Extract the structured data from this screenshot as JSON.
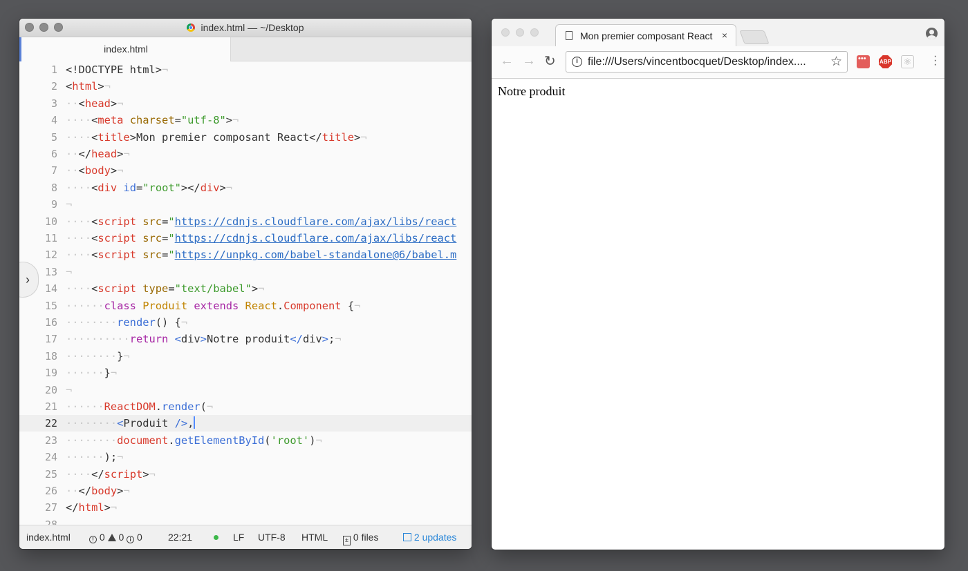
{
  "editor": {
    "window_title": "index.html — ~/Desktop",
    "tab_label": "index.html",
    "lines": [
      {
        "n": "1",
        "tokens": [
          [
            "pl",
            "<!DOCTYPE html>"
          ],
          [
            "eol",
            "¬"
          ]
        ]
      },
      {
        "n": "2",
        "tokens": [
          [
            "pl",
            "<"
          ],
          [
            "tag",
            "html"
          ],
          [
            "pl",
            ">"
          ],
          [
            "eol",
            "¬"
          ]
        ]
      },
      {
        "n": "3",
        "tokens": [
          [
            "ind",
            "··"
          ],
          [
            "pl",
            "<"
          ],
          [
            "tag",
            "head"
          ],
          [
            "pl",
            ">"
          ],
          [
            "eol",
            "¬"
          ]
        ]
      },
      {
        "n": "4",
        "tokens": [
          [
            "ind",
            "····"
          ],
          [
            "pl",
            "<"
          ],
          [
            "tag",
            "meta"
          ],
          [
            "pl",
            " "
          ],
          [
            "attr",
            "charset"
          ],
          [
            "pl",
            "="
          ],
          [
            "str",
            "\"utf-8\""
          ],
          [
            "pl",
            ">"
          ],
          [
            "eol",
            "¬"
          ]
        ]
      },
      {
        "n": "5",
        "tokens": [
          [
            "ind",
            "····"
          ],
          [
            "pl",
            "<"
          ],
          [
            "tag",
            "title"
          ],
          [
            "pl",
            ">Mon premier composant React</"
          ],
          [
            "tag",
            "title"
          ],
          [
            "pl",
            ">"
          ],
          [
            "eol",
            "¬"
          ]
        ]
      },
      {
        "n": "6",
        "tokens": [
          [
            "ind",
            "··"
          ],
          [
            "pl",
            "</"
          ],
          [
            "tag",
            "head"
          ],
          [
            "pl",
            ">"
          ],
          [
            "eol",
            "¬"
          ]
        ]
      },
      {
        "n": "7",
        "tokens": [
          [
            "ind",
            "··"
          ],
          [
            "pl",
            "<"
          ],
          [
            "tag",
            "body"
          ],
          [
            "pl",
            ">"
          ],
          [
            "eol",
            "¬"
          ]
        ]
      },
      {
        "n": "8",
        "tokens": [
          [
            "ind",
            "····"
          ],
          [
            "pl",
            "<"
          ],
          [
            "tag",
            "div"
          ],
          [
            "pl",
            " "
          ],
          [
            "fn",
            "id"
          ],
          [
            "pl",
            "="
          ],
          [
            "str",
            "\"root\""
          ],
          [
            "pl",
            "></"
          ],
          [
            "tag",
            "div"
          ],
          [
            "pl",
            ">"
          ],
          [
            "eol",
            "¬"
          ]
        ]
      },
      {
        "n": "9",
        "tokens": [
          [
            "eol",
            "¬"
          ]
        ]
      },
      {
        "n": "10",
        "tokens": [
          [
            "ind",
            "····"
          ],
          [
            "pl",
            "<"
          ],
          [
            "tag",
            "script"
          ],
          [
            "pl",
            " "
          ],
          [
            "attr",
            "src"
          ],
          [
            "pl",
            "="
          ],
          [
            "str",
            "\""
          ],
          [
            "url",
            "https://cdnjs.cloudflare.com/ajax/libs/react"
          ]
        ]
      },
      {
        "n": "11",
        "tokens": [
          [
            "ind",
            "····"
          ],
          [
            "pl",
            "<"
          ],
          [
            "tag",
            "script"
          ],
          [
            "pl",
            " "
          ],
          [
            "attr",
            "src"
          ],
          [
            "pl",
            "="
          ],
          [
            "str",
            "\""
          ],
          [
            "url",
            "https://cdnjs.cloudflare.com/ajax/libs/react"
          ]
        ]
      },
      {
        "n": "12",
        "tokens": [
          [
            "ind",
            "····"
          ],
          [
            "pl",
            "<"
          ],
          [
            "tag",
            "script"
          ],
          [
            "pl",
            " "
          ],
          [
            "attr",
            "src"
          ],
          [
            "pl",
            "="
          ],
          [
            "str",
            "\""
          ],
          [
            "url",
            "https://unpkg.com/babel-standalone@6/babel.m"
          ]
        ]
      },
      {
        "n": "13",
        "tokens": [
          [
            "eol",
            "¬"
          ]
        ]
      },
      {
        "n": "14",
        "tokens": [
          [
            "ind",
            "····"
          ],
          [
            "pl",
            "<"
          ],
          [
            "tag",
            "script"
          ],
          [
            "pl",
            " "
          ],
          [
            "attr",
            "type"
          ],
          [
            "pl",
            "="
          ],
          [
            "str",
            "\"text/babel\""
          ],
          [
            "pl",
            ">"
          ],
          [
            "eol",
            "¬"
          ]
        ]
      },
      {
        "n": "15",
        "tokens": [
          [
            "ind",
            "······"
          ],
          [
            "kw",
            "class"
          ],
          [
            "pl",
            " "
          ],
          [
            "cls",
            "Produit"
          ],
          [
            "pl",
            " "
          ],
          [
            "kw",
            "extends"
          ],
          [
            "pl",
            " "
          ],
          [
            "cls",
            "React"
          ],
          [
            "pl",
            "."
          ],
          [
            "obj",
            "Component"
          ],
          [
            "pl",
            " {"
          ],
          [
            "eol",
            "¬"
          ]
        ]
      },
      {
        "n": "16",
        "tokens": [
          [
            "ind",
            "········"
          ],
          [
            "fn",
            "render"
          ],
          [
            "pl",
            "() {"
          ],
          [
            "eol",
            "¬"
          ]
        ]
      },
      {
        "n": "17",
        "tokens": [
          [
            "ind",
            "··········"
          ],
          [
            "kw",
            "return"
          ],
          [
            "pl",
            " "
          ],
          [
            "fn",
            "<"
          ],
          [
            "pl",
            "div"
          ],
          [
            "fn",
            ">"
          ],
          [
            "pl",
            "Notre produit"
          ],
          [
            "fn",
            "</"
          ],
          [
            "pl",
            "div"
          ],
          [
            "fn",
            ">"
          ],
          [
            "pl",
            ";"
          ],
          [
            "eol",
            "¬"
          ]
        ]
      },
      {
        "n": "18",
        "tokens": [
          [
            "ind",
            "········"
          ],
          [
            "pl",
            "}"
          ],
          [
            "eol",
            "¬"
          ]
        ]
      },
      {
        "n": "19",
        "tokens": [
          [
            "ind",
            "······"
          ],
          [
            "pl",
            "}"
          ],
          [
            "eol",
            "¬"
          ]
        ]
      },
      {
        "n": "20",
        "tokens": [
          [
            "eol",
            "¬"
          ]
        ]
      },
      {
        "n": "21",
        "tokens": [
          [
            "ind",
            "······"
          ],
          [
            "obj",
            "ReactDOM"
          ],
          [
            "pl",
            "."
          ],
          [
            "fn",
            "render"
          ],
          [
            "pl",
            "("
          ],
          [
            "eol",
            "¬"
          ]
        ]
      },
      {
        "n": "22",
        "tokens": [
          [
            "ind",
            "········"
          ],
          [
            "fn",
            "<"
          ],
          [
            "pl",
            "Produit "
          ],
          [
            "fn",
            "/>"
          ],
          [
            "pl",
            ","
          ]
        ]
      },
      {
        "n": "23",
        "tokens": [
          [
            "ind",
            "········"
          ],
          [
            "obj",
            "document"
          ],
          [
            "pl",
            "."
          ],
          [
            "fn",
            "getElementById"
          ],
          [
            "pl",
            "("
          ],
          [
            "str",
            "'root'"
          ],
          [
            "pl",
            ")"
          ],
          [
            "eol",
            "¬"
          ]
        ]
      },
      {
        "n": "24",
        "tokens": [
          [
            "ind",
            "······"
          ],
          [
            "pl",
            ");"
          ],
          [
            "eol",
            "¬"
          ]
        ]
      },
      {
        "n": "25",
        "tokens": [
          [
            "ind",
            "····"
          ],
          [
            "pl",
            "</"
          ],
          [
            "tag",
            "script"
          ],
          [
            "pl",
            ">"
          ],
          [
            "eol",
            "¬"
          ]
        ]
      },
      {
        "n": "26",
        "tokens": [
          [
            "ind",
            "··"
          ],
          [
            "pl",
            "</"
          ],
          [
            "tag",
            "body"
          ],
          [
            "pl",
            ">"
          ],
          [
            "eol",
            "¬"
          ]
        ]
      },
      {
        "n": "27",
        "tokens": [
          [
            "pl",
            "</"
          ],
          [
            "tag",
            "html"
          ],
          [
            "pl",
            ">"
          ],
          [
            "eol",
            "¬"
          ]
        ]
      },
      {
        "n": "28",
        "tokens": []
      }
    ],
    "current_line": "22",
    "status": {
      "file": "index.html",
      "errors": "0",
      "warnings": "0",
      "infos": "0",
      "cursor_pos": "22:21",
      "line_ending": "LF",
      "encoding": "UTF-8",
      "grammar": "HTML",
      "git_files": "0 files",
      "updates": "2 updates"
    }
  },
  "browser": {
    "tab_title": "Mon premier composant React",
    "tab_close": "×",
    "url": "file:///Users/vincentbocquet/Desktop/index....",
    "ext_abp": "ABP",
    "page_text": "Notre produit"
  }
}
